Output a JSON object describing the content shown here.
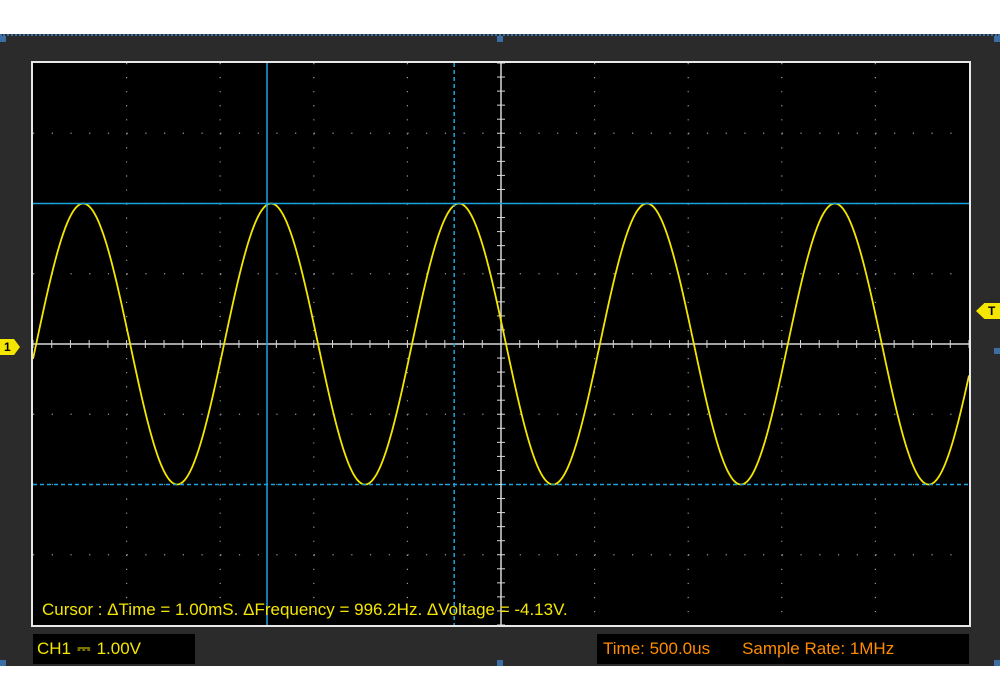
{
  "colors": {
    "frame_bg": "#2b2b2b",
    "screen_bg": "#000000",
    "waveform": "#f5e600",
    "cursor": "#1aa3e0",
    "grid": "#9a9a9a",
    "axis": "#d8d8d8",
    "status_orange": "#ff8c00",
    "marker_yellow": "#f5e600"
  },
  "markers": {
    "channel": "1",
    "trigger": "T"
  },
  "readout": {
    "cursor_text": "Cursor : ΔTime = 1.00mS. ΔFrequency = 996.2Hz. ΔVoltage = -4.13V."
  },
  "status": {
    "channel_label": "CH1",
    "coupling_symbol": "⎓",
    "volts_per_div": "1.00V",
    "timebase": "Time: 500.0us",
    "sample_rate": "Sample Rate: 1MHz"
  },
  "signal": {
    "frequency_hz": 996.2,
    "amplitude_div": 2.0,
    "time_per_div_us": 500
  },
  "cursors": {
    "time_div": [
      2.5,
      4.5
    ],
    "voltage_div": [
      2.0,
      -2.0
    ]
  }
}
